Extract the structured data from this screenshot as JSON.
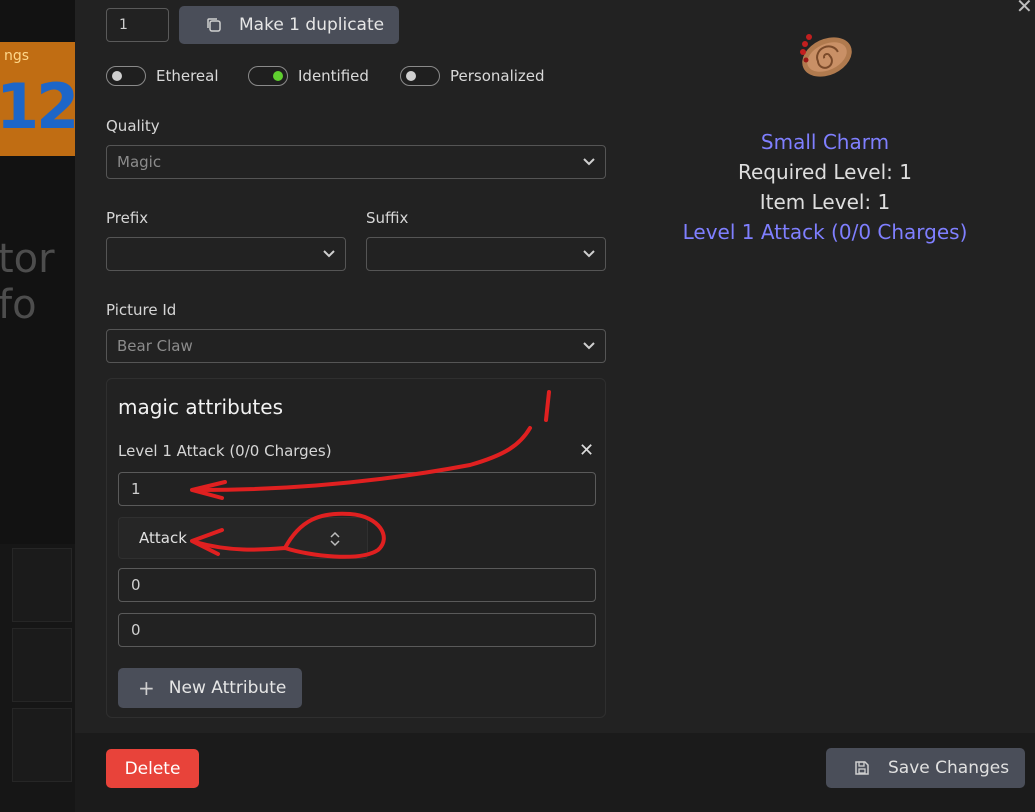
{
  "background": {
    "banner_small_text": "ngs",
    "banner_number": "12",
    "partial_text": "tor fo"
  },
  "form": {
    "duplicate_count": "1",
    "duplicate_button_label": "Make 1 duplicate",
    "toggles": [
      {
        "label": "Ethereal",
        "on": false
      },
      {
        "label": "Identified",
        "on": true
      },
      {
        "label": "Personalized",
        "on": false
      }
    ],
    "quality_label": "Quality",
    "quality_value": "Magic",
    "prefix_label": "Prefix",
    "prefix_value": "",
    "suffix_label": "Suffix",
    "suffix_value": "",
    "picture_id_label": "Picture Id",
    "picture_id_value": "Bear Claw"
  },
  "attributes_panel": {
    "title": "magic attributes",
    "attribute_name": "Level 1 Attack (0/0 Charges)",
    "value_1": "1",
    "skill_select": "Attack",
    "value_2": "0",
    "value_3": "0",
    "new_attribute_label": "New Attribute"
  },
  "preview": {
    "item_name": "Small Charm",
    "required_level": "Required Level: 1",
    "item_level": "Item Level: 1",
    "property": "Level 1 Attack (0/0 Charges)",
    "name_color": "#7f7fff",
    "stat_color": "#dedede"
  },
  "footer": {
    "delete_label": "Delete",
    "save_label": "Save Changes",
    "delete_color": "#e8433a"
  },
  "annotation": {
    "mark": "1",
    "color": "#e02020"
  }
}
